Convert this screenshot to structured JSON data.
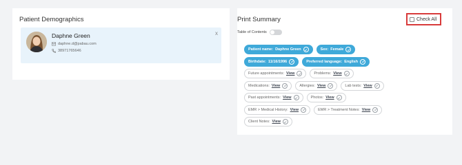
{
  "demographics": {
    "title": "Patient Demographics",
    "name": "Daphne Green",
    "email": "daphne.d@pabau.com",
    "phone": "38971765646",
    "close": "x"
  },
  "summary": {
    "title": "Print Summary",
    "toc_label": "Table of Contents",
    "toc_enabled": false,
    "check_all": "Check All",
    "rows": [
      [
        {
          "label": "Patient name:",
          "value": "Daphne Green",
          "filled": true
        },
        {
          "label": "Sex:",
          "value": "Female",
          "filled": true
        }
      ],
      [
        {
          "label": "Birthdate:",
          "value": "11/16/1996",
          "filled": true
        },
        {
          "label": "Preferred language:",
          "value": "English",
          "filled": true
        }
      ],
      [
        {
          "label": "Future appointments:",
          "value": "View",
          "filled": false
        },
        {
          "label": "Problems:",
          "value": "View",
          "filled": false
        }
      ],
      [
        {
          "label": "Medications:",
          "value": "View",
          "filled": false
        },
        {
          "label": "Allergies:",
          "value": "View",
          "filled": false
        },
        {
          "label": "Lab tests:",
          "value": "View",
          "filled": false
        }
      ],
      [
        {
          "label": "Past appointments:",
          "value": "View",
          "filled": false
        },
        {
          "label": "Photos:",
          "value": "View",
          "filled": false
        }
      ],
      [
        {
          "label": "EMR > Medical History:",
          "value": "View",
          "filled": false
        },
        {
          "label": "EMR > Treatment Notes:",
          "value": "View",
          "filled": false
        }
      ],
      [
        {
          "label": "Client Notes:",
          "value": "View",
          "filled": false
        }
      ]
    ]
  },
  "colors": {
    "accent": "#3fa9d9",
    "highlight": "#d83a3a"
  }
}
